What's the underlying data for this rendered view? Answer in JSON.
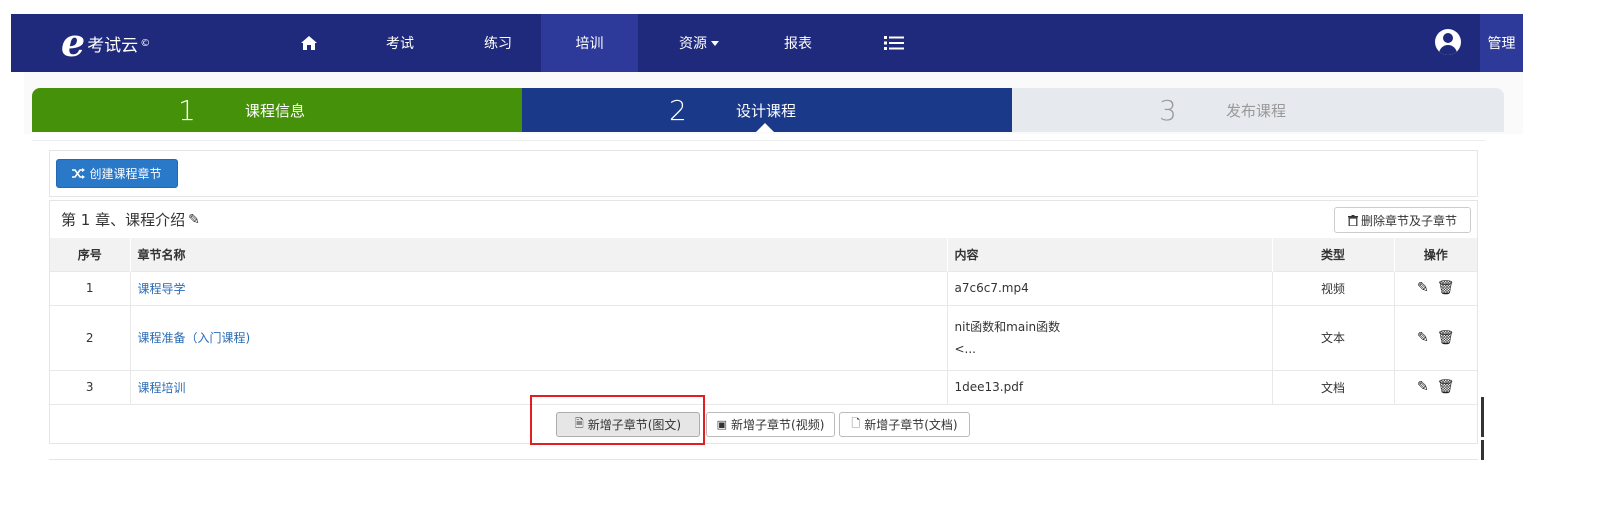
{
  "navbar": {
    "brand_text": "考试云",
    "brand_mark": "©",
    "items": [
      {
        "label": "",
        "icon": "home-icon"
      },
      {
        "label": "考试"
      },
      {
        "label": "练习"
      },
      {
        "label": "培训",
        "active": true
      },
      {
        "label": "资源",
        "dropdown": true
      },
      {
        "label": "报表"
      },
      {
        "label": "",
        "icon": "list-icon"
      }
    ],
    "manage_label": "管理"
  },
  "steps": [
    {
      "num": "1",
      "label": "课程信息",
      "state": "done",
      "color": "#46910a"
    },
    {
      "num": "2",
      "label": "设计课程",
      "state": "current",
      "color": "#1a3989"
    },
    {
      "num": "3",
      "label": "发布课程",
      "state": "pending",
      "color": "#e6eaee"
    }
  ],
  "toolbar": {
    "create_chapter_label": "创建课程章节"
  },
  "chapter": {
    "title": "第 1 章、课程介绍",
    "delete_label": "删除章节及子章节",
    "columns": [
      "序号",
      "章节名称",
      "内容",
      "类型",
      "操作"
    ],
    "rows": [
      {
        "index": "1",
        "name": "课程导学",
        "content_line1": "a7c6c7.mp4",
        "content_line2": "",
        "type": "视频"
      },
      {
        "index": "2",
        "name": "课程准备（入门课程)",
        "content_line1": "nit函数和main函数",
        "content_line2": "<...",
        "type": "文本"
      },
      {
        "index": "3",
        "name": "课程培训",
        "content_line1": "1dee13.pdf",
        "content_line2": "",
        "type": "文档"
      }
    ],
    "add_buttons": {
      "image_text": "新增子章节(图文)",
      "video": "新增子章节(视频)",
      "document": "新增子章节(文档)"
    }
  },
  "colors": {
    "navbar_bg": "#1f2a7c",
    "primary_button": "#2a78c8",
    "link": "#2a6bb5",
    "highlight": "#e02020"
  }
}
